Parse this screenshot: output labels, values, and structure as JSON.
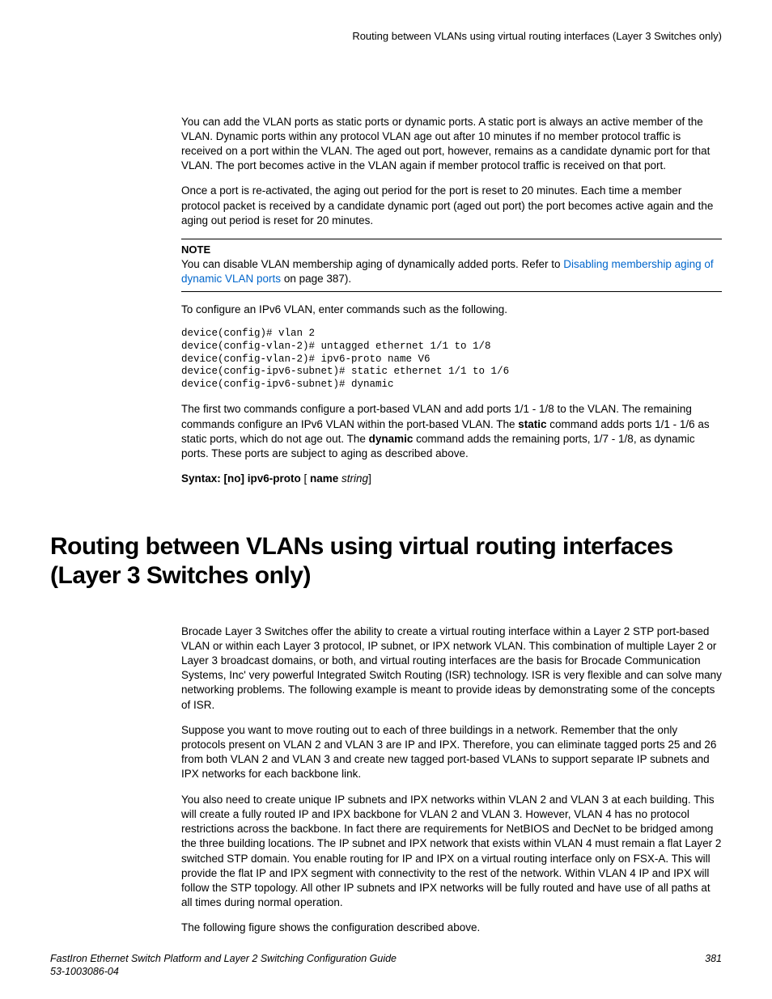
{
  "header": {
    "title": "Routing between VLANs using virtual routing interfaces (Layer 3 Switches only)"
  },
  "body": {
    "p1": "You can add the VLAN ports as static ports or dynamic ports. A static port is always an active member of the VLAN. Dynamic ports within any protocol VLAN age out after 10 minutes if no member protocol traffic is received on a port within the VLAN. The aged out port, however, remains as a candidate dynamic port for that VLAN. The port becomes active in the VLAN again if member protocol traffic is received on that port.",
    "p2": "Once a port is re-activated, the aging out period for the port is reset to 20 minutes. Each time a member protocol packet is received by a candidate dynamic port (aged out port) the port becomes active again and the aging out period is reset for 20 minutes.",
    "note": {
      "label": "NOTE",
      "text_before_link": "You can disable VLAN membership aging of dynamically added ports. Refer to ",
      "link_text": "Disabling membership aging of dynamic VLAN ports",
      "text_after_link": " on page 387)."
    },
    "p3": "To configure an IPv6 VLAN, enter commands such as the following.",
    "code": "device(config)# vlan 2\ndevice(config-vlan-2)# untagged ethernet 1/1 to 1/8\ndevice(config-vlan-2)# ipv6-proto name V6\ndevice(config-ipv6-subnet)# static ethernet 1/1 to 1/6\ndevice(config-ipv6-subnet)# dynamic",
    "p4_a": "The first two commands configure a port-based VLAN and add ports 1/1 - 1/8 to the VLAN. The remaining commands configure an IPv6 VLAN within the port-based VLAN. The ",
    "p4_b": "static",
    "p4_c": " command adds ports 1/1 - 1/6 as static ports, which do not age out. The ",
    "p4_d": "dynamic",
    "p4_e": " command adds the remaining ports, 1/7 - 1/8, as dynamic ports. These ports are subject to aging as described above.",
    "syntax": {
      "prefix": "Syntax: [no] ipv6-proto ",
      "bracket_open": "[ ",
      "name": "name ",
      "string": "string",
      "bracket_close": "]"
    },
    "heading": "Routing between VLANs using virtual routing interfaces (Layer 3 Switches only)",
    "p5": "Brocade Layer 3 Switches offer the ability to create a virtual routing interface within a Layer 2 STP port-based VLAN or within each Layer 3 protocol, IP subnet, or IPX network VLAN. This combination of multiple Layer 2 or Layer 3 broadcast domains, or both, and virtual routing interfaces are the basis for Brocade Communication Systems, Inc' very powerful Integrated Switch Routing (ISR) technology. ISR is very flexible and can solve many networking problems. The following example is meant to provide ideas by demonstrating some of the concepts of ISR.",
    "p6": "Suppose you want to move routing out to each of three buildings in a network. Remember that the only protocols present on VLAN 2 and VLAN 3 are IP and IPX. Therefore, you can eliminate tagged ports 25 and 26 from both VLAN 2 and VLAN 3 and create new tagged port-based VLANs to support separate IP subnets and IPX networks for each backbone link.",
    "p7": "You also need to create unique IP subnets and IPX networks within VLAN 2 and VLAN 3 at each building. This will create a fully routed IP and IPX backbone for VLAN 2 and VLAN 3. However, VLAN 4 has no protocol restrictions across the backbone. In fact there are requirements for NetBIOS and DecNet to be bridged among the three building locations. The IP subnet and IPX network that exists within VLAN 4 must remain a flat Layer 2 switched STP domain. You enable routing for IP and IPX on a virtual routing interface only on FSX-A. This will provide the flat IP and IPX segment with connectivity to the rest of the network. Within VLAN 4 IP and IPX will follow the STP topology. All other IP subnets and IPX networks will be fully routed and have use of all paths at all times during normal operation.",
    "p8": "The following figure shows the configuration described above."
  },
  "footer": {
    "guide": "FastIron Ethernet Switch Platform and Layer 2 Switching Configuration Guide",
    "docnum": "53-1003086-04",
    "page": "381"
  }
}
